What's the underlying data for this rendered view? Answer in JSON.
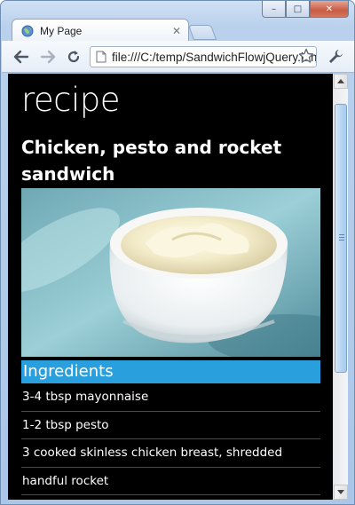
{
  "window": {
    "controls": {
      "minimize_glyph": "–",
      "maximize_glyph": "□",
      "close_glyph": "✕"
    }
  },
  "tab": {
    "title": "My Page",
    "close_glyph": "✕"
  },
  "toolbar": {
    "address": "file:///C:/temp/SandwichFlowjQuery.html"
  },
  "page": {
    "heading": "recipe",
    "recipe_title": "Chicken, pesto and rocket sandwich",
    "ingredients_header": "Ingredients",
    "ingredients": [
      "3-4 tbsp mayonnaise",
      "1-2 tbsp pesto",
      "3 cooked skinless chicken breast, shredded",
      "handful rocket"
    ]
  },
  "colors": {
    "accent": "#2a9fdd",
    "page_background": "#000000",
    "text": "#ffffff"
  },
  "icons": [
    "globe-icon",
    "back-arrow-icon",
    "forward-arrow-icon",
    "reload-icon",
    "page-icon",
    "star-icon",
    "wrench-icon"
  ]
}
